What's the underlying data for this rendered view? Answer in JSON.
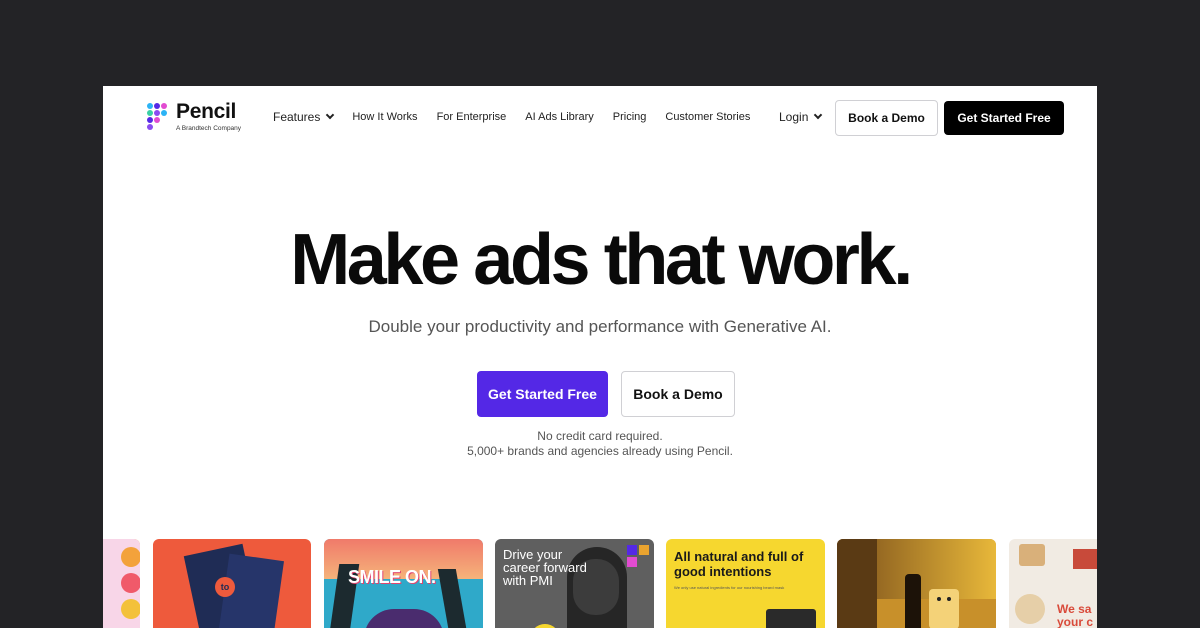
{
  "brand": {
    "name": "Pencil",
    "tagline": "A Brandtech Company",
    "logo_colors": [
      "#2bb3f5",
      "#5428e6",
      "#e24bd1",
      "#3ad0a5",
      "#8a4bf0"
    ]
  },
  "nav": {
    "items": [
      {
        "label": "Features",
        "has_dropdown": true
      },
      {
        "label": "How It Works"
      },
      {
        "label": "For Enterprise"
      },
      {
        "label": "AI Ads Library"
      },
      {
        "label": "Pricing"
      },
      {
        "label": "Customer Stories"
      }
    ],
    "login_label": "Login",
    "book_demo_label": "Book a Demo",
    "get_started_label": "Get Started Free"
  },
  "hero": {
    "headline": "Make ads that work.",
    "subheadline": "Double your productivity and performance with Generative AI.",
    "primary_cta": "Get Started Free",
    "secondary_cta": "Book a Demo",
    "note_line1": "No credit card required.",
    "note_line2": "5,000+ brands and agencies already using Pencil."
  },
  "gallery": [
    {
      "bg": "#f3a23b"
    },
    {
      "bg": "#ee5a3c",
      "text": "to"
    },
    {
      "bg": "#2fa9c9",
      "text": "SMILE ON."
    },
    {
      "bg": "#5a5a5a",
      "text": "Drive your career forward with PMI"
    },
    {
      "bg": "#f6d72f",
      "text": "All natural and full of good intentions",
      "subtext": "We only use natural ingredients for our nourishing beard mask"
    },
    {
      "bg": "#c8902a"
    },
    {
      "bg": "#f1ebe3",
      "text": "We sa your c"
    }
  ],
  "colors": {
    "accent": "#5428e6",
    "dark_button": "#000000",
    "backdrop": "#232326"
  }
}
